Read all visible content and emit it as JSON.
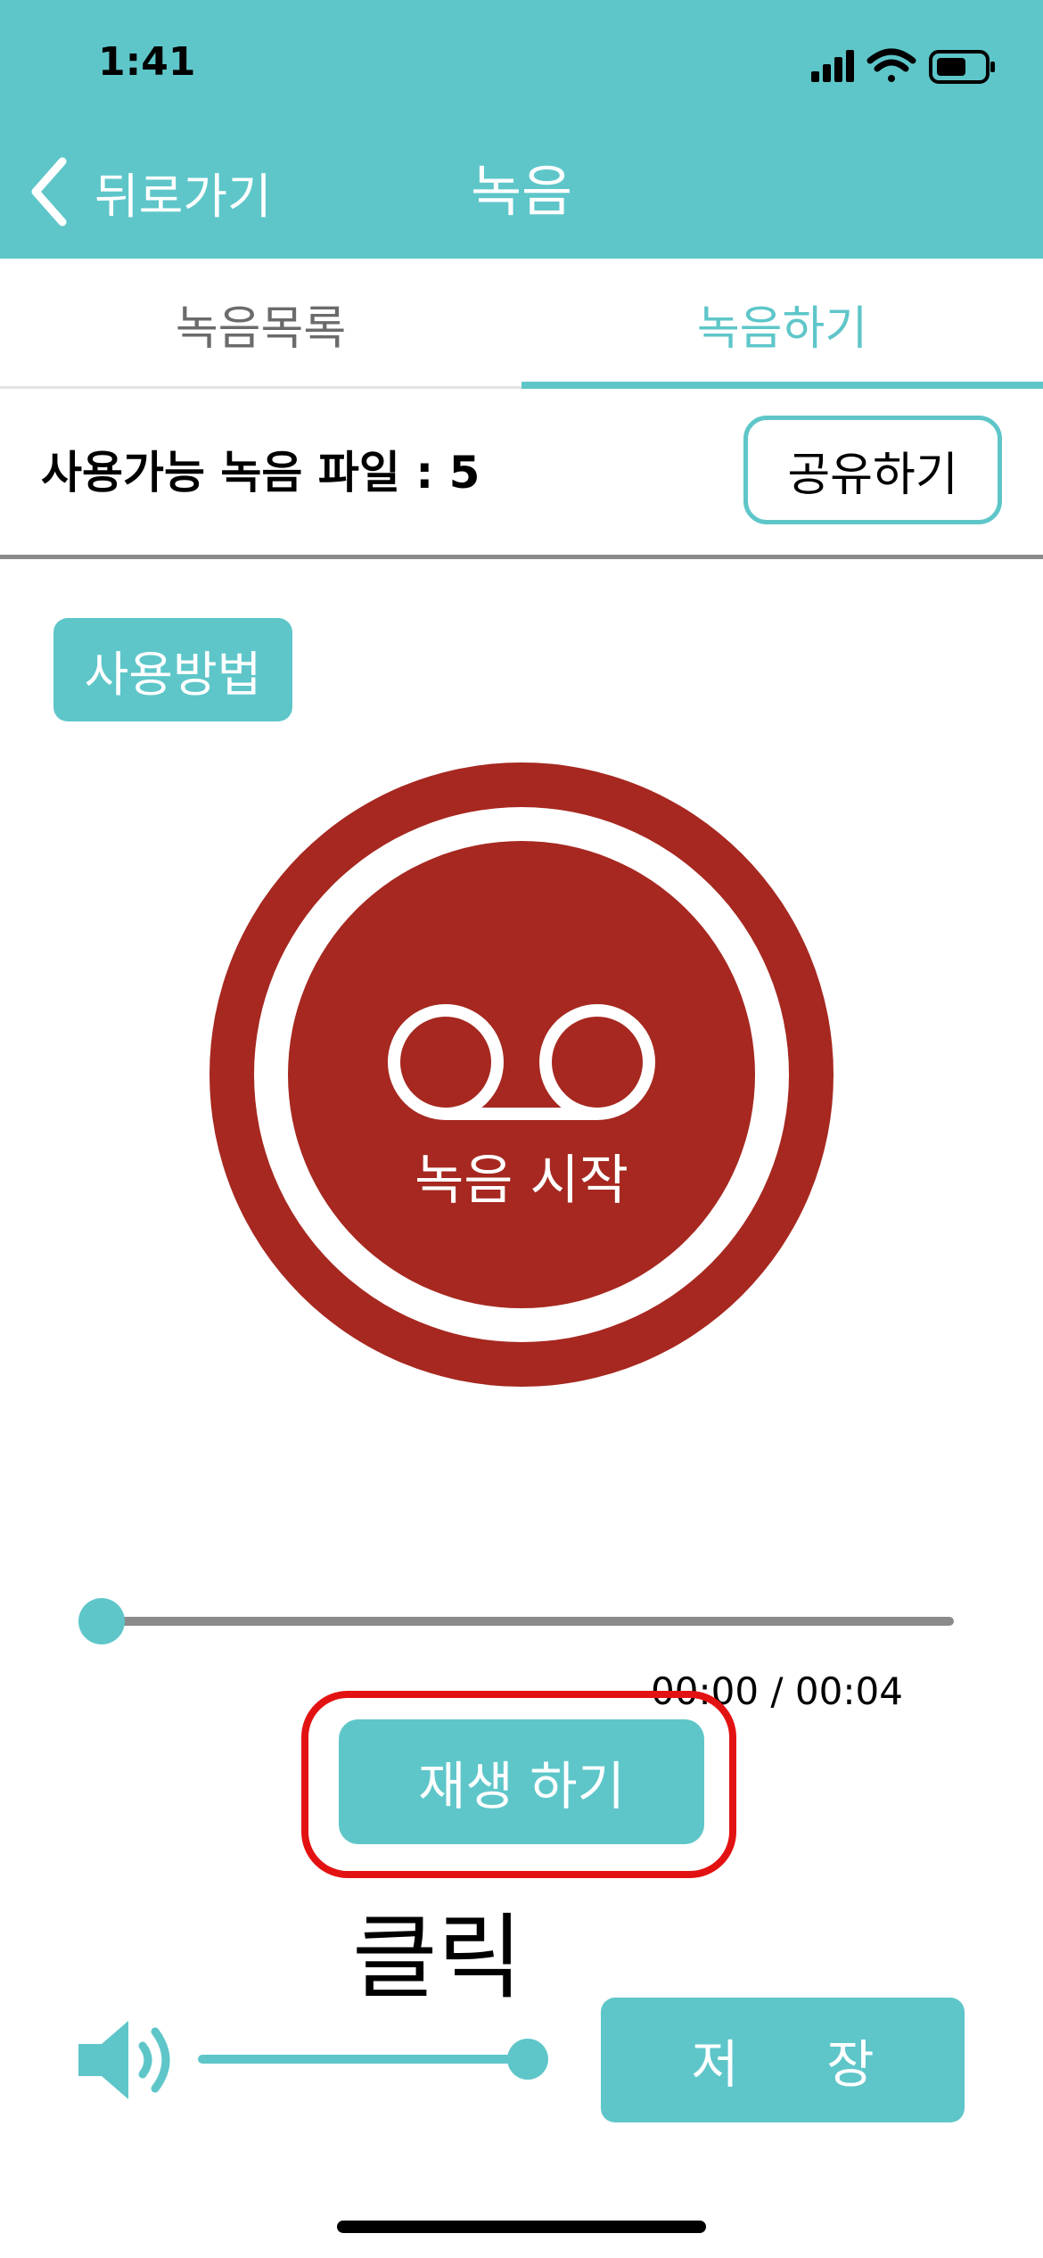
{
  "status_bar": {
    "time": "1:41"
  },
  "nav": {
    "back_label": "뒤로가기",
    "title": "녹음"
  },
  "tabs": [
    {
      "label": "녹음목록",
      "active": false
    },
    {
      "label": "녹음하기",
      "active": true
    }
  ],
  "info": {
    "available_text": "사용가능 녹음 파일 : 5",
    "share_label": "공유하기"
  },
  "howto_label": "사용방법",
  "record": {
    "label": "녹음 시작",
    "icon": "voicemail-icon"
  },
  "player": {
    "time": "00:00 / 00:04",
    "progress": 0,
    "play_label": "재생 하기"
  },
  "annotation": {
    "click_label": "클릭",
    "highlight_color": "#e31212"
  },
  "volume": {
    "level": 1.0,
    "icon": "speaker-icon"
  },
  "save_label": "저 장",
  "colors": {
    "accent": "#5ec6c9",
    "record_red": "#a62820",
    "divider": "#8b8b8b"
  }
}
